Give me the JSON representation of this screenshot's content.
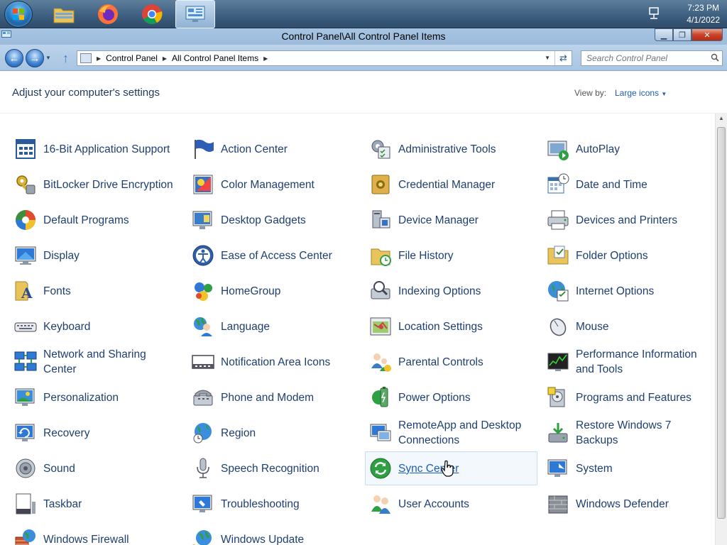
{
  "taskbar": {
    "apps": [
      {
        "name": "file-explorer",
        "active": false
      },
      {
        "name": "firefox",
        "active": false
      },
      {
        "name": "chrome",
        "active": false
      },
      {
        "name": "control-panel",
        "active": true
      }
    ],
    "clock_time": "7:23 PM",
    "clock_date": "4/1/2022"
  },
  "window": {
    "title": "Control Panel\\All Control Panel Items",
    "minimize_glyph": "▁",
    "maximize_glyph": "❐",
    "close_glyph": "✕"
  },
  "address": {
    "breadcrumbs": [
      "Control Panel",
      "All Control Panel Items"
    ],
    "search_placeholder": "Search Control Panel"
  },
  "header": {
    "title": "Adjust your computer's settings",
    "view_by_label": "View by:",
    "view_mode": "Large icons"
  },
  "items": [
    {
      "label": "16-Bit Application Support",
      "icon": "dos-window-icon"
    },
    {
      "label": "Action Center",
      "icon": "flag-icon"
    },
    {
      "label": "Administrative Tools",
      "icon": "admin-tools-icon"
    },
    {
      "label": "AutoPlay",
      "icon": "autoplay-icon"
    },
    {
      "label": "BitLocker Drive Encryption",
      "icon": "key-lock-icon"
    },
    {
      "label": "Color Management",
      "icon": "color-icon"
    },
    {
      "label": "Credential Manager",
      "icon": "vault-icon"
    },
    {
      "label": "Date and Time",
      "icon": "calendar-clock-icon"
    },
    {
      "label": "Default Programs",
      "icon": "default-programs-icon"
    },
    {
      "label": "Desktop Gadgets",
      "icon": "gadgets-icon"
    },
    {
      "label": "Device Manager",
      "icon": "device-manager-icon"
    },
    {
      "label": "Devices and Printers",
      "icon": "printer-icon"
    },
    {
      "label": "Display",
      "icon": "monitor-icon"
    },
    {
      "label": "Ease of Access Center",
      "icon": "ease-access-icon"
    },
    {
      "label": "File History",
      "icon": "file-history-icon"
    },
    {
      "label": "Folder Options",
      "icon": "folder-icon"
    },
    {
      "label": "Fonts",
      "icon": "fonts-icon"
    },
    {
      "label": "HomeGroup",
      "icon": "homegroup-icon"
    },
    {
      "label": "Indexing Options",
      "icon": "indexing-icon"
    },
    {
      "label": "Internet Options",
      "icon": "globe-icon"
    },
    {
      "label": "Keyboard",
      "icon": "keyboard-icon"
    },
    {
      "label": "Language",
      "icon": "language-icon"
    },
    {
      "label": "Location Settings",
      "icon": "location-icon"
    },
    {
      "label": "Mouse",
      "icon": "mouse-icon"
    },
    {
      "label": "Network and Sharing Center",
      "icon": "network-icon"
    },
    {
      "label": "Notification Area Icons",
      "icon": "notification-icon"
    },
    {
      "label": "Parental Controls",
      "icon": "parental-icon"
    },
    {
      "label": "Performance Information and Tools",
      "icon": "performance-icon"
    },
    {
      "label": "Personalization",
      "icon": "personalization-icon"
    },
    {
      "label": "Phone and Modem",
      "icon": "phone-icon"
    },
    {
      "label": "Power Options",
      "icon": "battery-icon"
    },
    {
      "label": "Programs and Features",
      "icon": "programs-icon"
    },
    {
      "label": "Recovery",
      "icon": "recovery-icon"
    },
    {
      "label": "Region",
      "icon": "region-icon"
    },
    {
      "label": "RemoteApp and Desktop Connections",
      "icon": "remote-icon"
    },
    {
      "label": "Restore Windows 7 Backups",
      "icon": "backup-icon"
    },
    {
      "label": "Sound",
      "icon": "speaker-icon"
    },
    {
      "label": "Speech Recognition",
      "icon": "microphone-icon"
    },
    {
      "label": "Sync Center",
      "icon": "sync-icon"
    },
    {
      "label": "System",
      "icon": "system-icon"
    },
    {
      "label": "Taskbar",
      "icon": "taskbar-icon"
    },
    {
      "label": "Troubleshooting",
      "icon": "troubleshoot-icon"
    },
    {
      "label": "User Accounts",
      "icon": "users-icon"
    },
    {
      "label": "Windows Defender",
      "icon": "defender-icon"
    },
    {
      "label": "Windows Firewall",
      "icon": "firewall-icon"
    },
    {
      "label": "Windows Update",
      "icon": "update-icon"
    }
  ],
  "hovered_item": "Sync Center",
  "colors": {
    "link": "#1e3f6f",
    "accent": "#1e5eb0",
    "taskbar": "#3c5d7e",
    "titlebar": "#a6c4e2"
  }
}
